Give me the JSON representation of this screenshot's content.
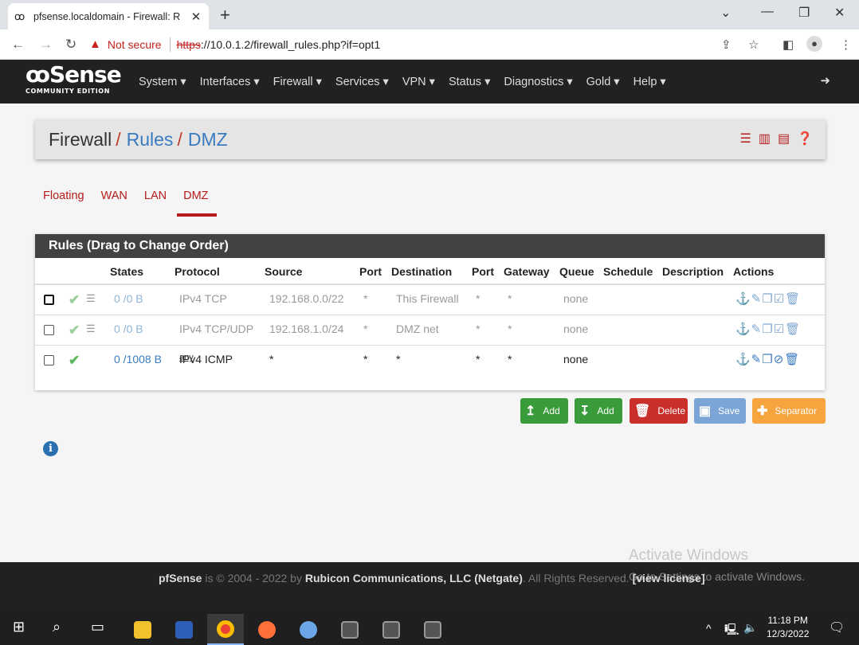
{
  "browser": {
    "tab_title": "pfsense.localdomain - Firewall: R",
    "tab_close": "✕",
    "new_tab": "+",
    "not_secure": "Not secure",
    "url_scheme": "https",
    "url_rest": "://10.0.1.2/firewall_rules.php?if=opt1"
  },
  "nav": {
    "logo": "Sense",
    "logo_sub": "COMMUNITY EDITION",
    "menu": [
      "System ▾",
      "Interfaces ▾",
      "Firewall ▾",
      "Services ▾",
      "VPN ▾",
      "Status ▾",
      "Diagnostics ▾",
      "Gold ▾",
      "Help ▾"
    ]
  },
  "breadcrumb": {
    "root": "Firewall",
    "mid": "Rules",
    "leaf": "DMZ"
  },
  "tabs": [
    "Floating",
    "WAN",
    "LAN",
    "DMZ"
  ],
  "panel": {
    "title": "Rules (Drag to Change Order)",
    "columns": [
      "States",
      "Protocol",
      "Source",
      "Port",
      "Destination",
      "Port",
      "Gateway",
      "Queue",
      "Schedule",
      "Description",
      "Actions"
    ]
  },
  "rules": [
    {
      "states": "0 /0 B",
      "protocol": "IPv4 TCP",
      "source": "192.168.0.0/22",
      "sport": "*",
      "destination": "This Firewall",
      "dport": "*",
      "gateway": "*",
      "queue": "none",
      "actions": "⚓✎❐☑🗑"
    },
    {
      "states": "0 /0 B",
      "protocol": "IPv4 TCP/UDP",
      "source": "192.168.1.0/24",
      "sport": "*",
      "destination": "DMZ net",
      "dport": "*",
      "gateway": "*",
      "queue": "none",
      "actions": "⚓✎❐☑🗑"
    },
    {
      "states": "0 /1008 B",
      "protocol": "IPv4 ICMP",
      "protocol_sub": "any",
      "source": "*",
      "sport": "*",
      "destination": "*",
      "dport": "*",
      "gateway": "*",
      "queue": "none",
      "actions": "⚓✎❐⊘🗑"
    }
  ],
  "buttons": {
    "add_top": "Add",
    "add_bottom": "Add",
    "delete": "Delete",
    "save": "Save",
    "separator": "Separator"
  },
  "footer": {
    "brand": "pfSense",
    "mid": " is © 2004 - 2022 by ",
    "company": "Rubicon Communications, LLC (Netgate)",
    "rights": ". All Rights Reserved. ",
    "license": "[view license]"
  },
  "watermark": {
    "line1": "Activate Windows",
    "line2": "Go to Settings to activate Windows."
  },
  "clock": {
    "time": "11:18 PM",
    "date": "12/3/2022"
  },
  "colors": {
    "brand_red": "#b71c1c",
    "link_blue": "#3b7bbf",
    "nav_bg": "#212121"
  }
}
